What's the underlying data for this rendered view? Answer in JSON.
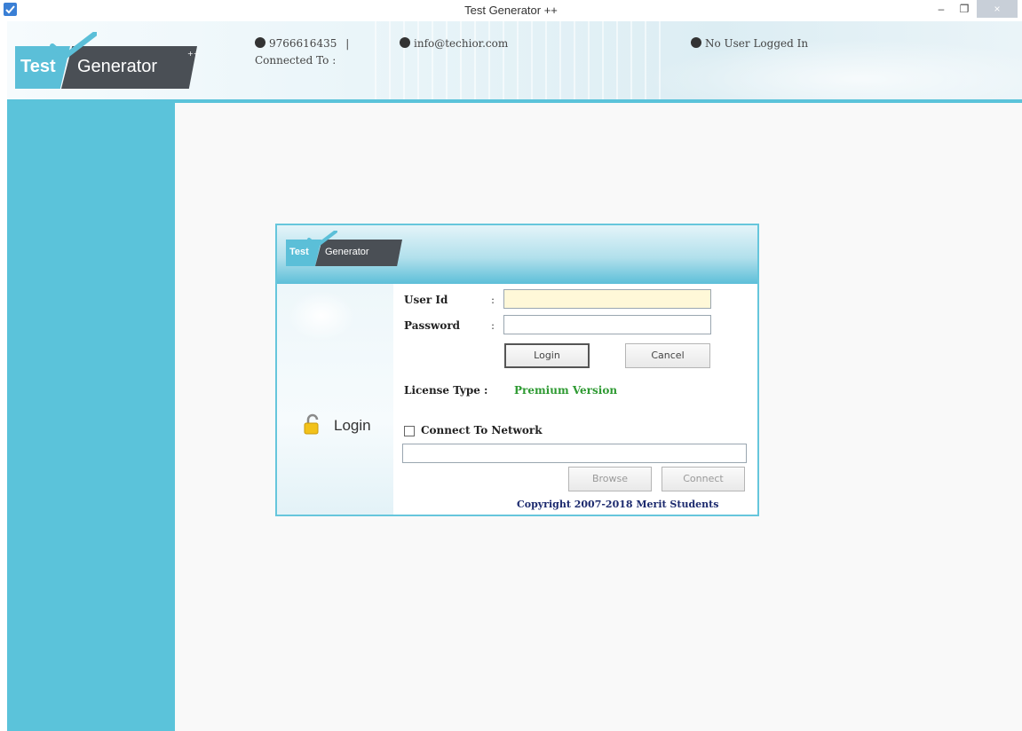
{
  "window": {
    "title": "Test Generator ++",
    "controls": {
      "minimize": "–",
      "restore": "❐",
      "close": "×"
    }
  },
  "header": {
    "logo_test": "Test",
    "logo_generator": "Generator",
    "logo_tm": "++",
    "phone": "9766616435",
    "separator": "|",
    "email": "info@techior.com",
    "user_status": "No User Logged In",
    "connected_to": "Connected To :"
  },
  "login": {
    "logo_test": "Test",
    "logo_generator": "Generator",
    "logo_tm": "++",
    "title": "Login",
    "user_id_label": "User Id",
    "password_label": "Password",
    "colon": ":",
    "user_id_value": "",
    "password_value": "",
    "login_button": "Login",
    "cancel_button": "Cancel",
    "license_label": "License Type :",
    "license_value": "Premium Version",
    "connect_network_label": "Connect To Network",
    "connect_network_checked": false,
    "network_path_value": "",
    "browse_button": "Browse",
    "connect_button": "Connect",
    "copyright": "Copyright 2007-2018 Merit Students"
  },
  "colors": {
    "accent": "#5bc3da",
    "logo_dark": "#4a4f55",
    "license_green": "#2e9a32",
    "copyright_navy": "#1c2a6e",
    "userid_bg": "#fff8d8"
  },
  "icons": {
    "app": "checkmark-icon",
    "phone": "phone-icon",
    "email": "email-icon",
    "user": "user-icon",
    "login": "lock-icon"
  }
}
